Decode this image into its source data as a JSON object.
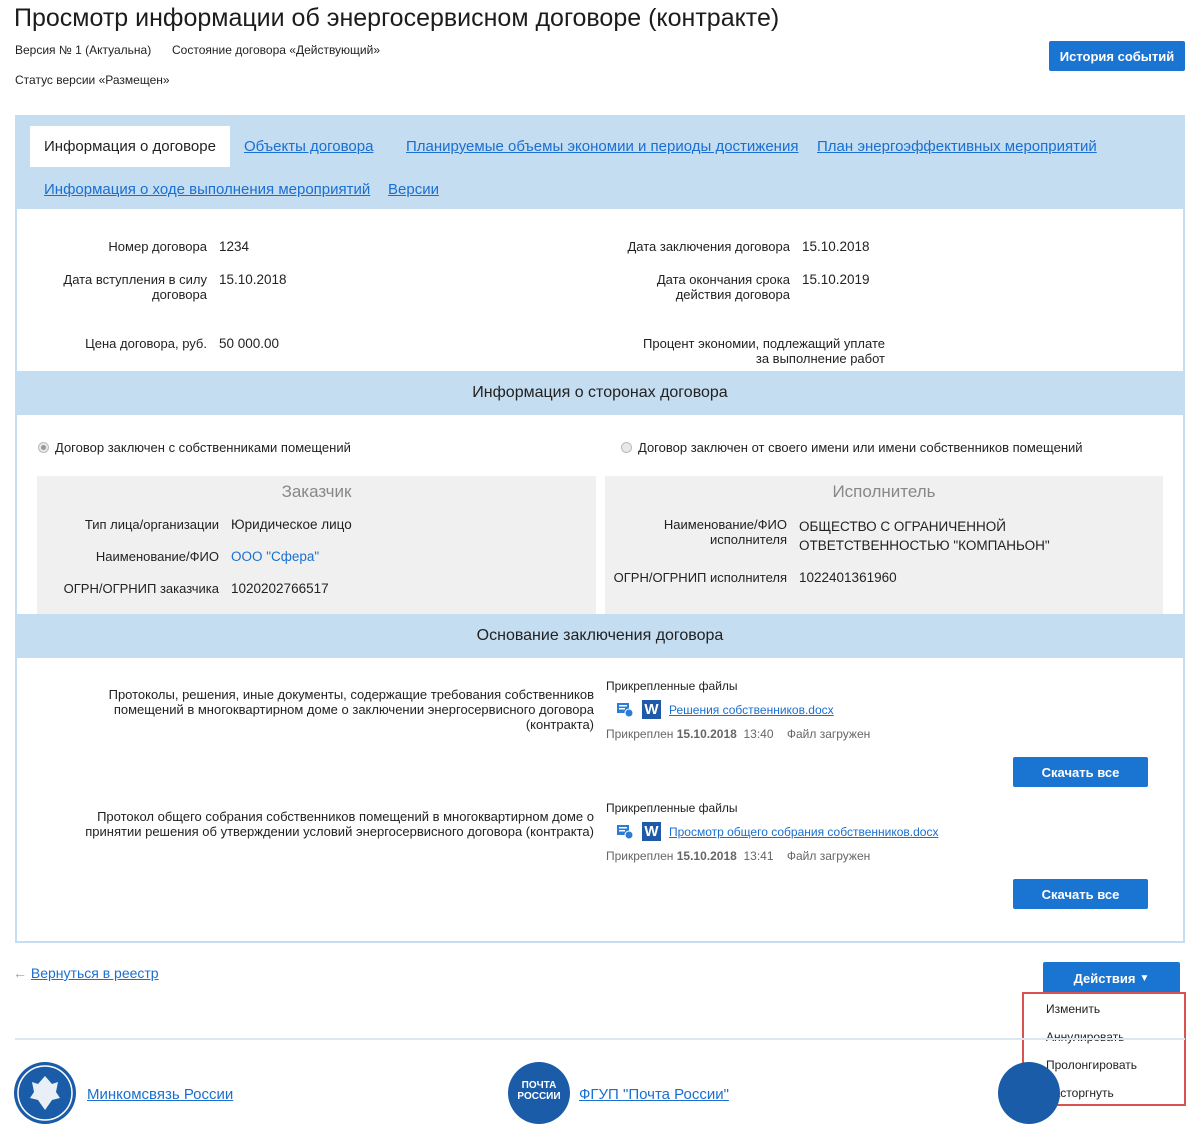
{
  "header": {
    "title": "Просмотр информации об энергосервисном договоре (контракте)",
    "version": "Версия № 1 (Актуальна)",
    "state": "Состояние договора «Действующий»",
    "version_status": "Статус версии «Размещен»",
    "history_button": "История событий"
  },
  "tabs": [
    {
      "label": "Информация о договоре",
      "active": true
    },
    {
      "label": "Объекты договора",
      "active": false
    },
    {
      "label": "Планируемые объемы экономии и периоды достижения",
      "active": false
    },
    {
      "label": "План энергоэффективных мероприятий",
      "active": false
    },
    {
      "label": "Информация о ходе выполнения мероприятий",
      "active": false
    },
    {
      "label": "Версии",
      "active": false
    }
  ],
  "contract": {
    "number_label": "Номер договора",
    "number": "1234",
    "effective_label": "Дата вступления в силу договора",
    "effective_date": "15.10.2018",
    "price_label": "Цена договора, руб.",
    "price": "50 000.00",
    "concluded_label": "Дата заключения договора",
    "concluded_date": "15.10.2018",
    "end_label": "Дата окончания срока действия договора",
    "end_date": "15.10.2019",
    "savings_label": "Процент экономии, подлежащий уплате за выполнение работ"
  },
  "parties": {
    "heading": "Информация о сторонах договора",
    "radio_owners": "Договор заключен с собственниками помещений",
    "radio_self": "Договор заключен от своего имени или имени собственников помещений",
    "customer": {
      "title": "Заказчик",
      "type_label": "Тип лица/организации",
      "type_value": "Юридическое лицо",
      "name_label": "Наименование/ФИО",
      "name_value": "ООО \"Сфера\"",
      "ogrn_label": "ОГРН/ОГРНИП заказчика",
      "ogrn_value": "1020202766517"
    },
    "executor": {
      "title": "Исполнитель",
      "name_label": "Наименование/ФИО исполнителя",
      "name_value": "ОБЩЕСТВО С ОГРАНИЧЕННОЙ ОТВЕТСТВЕННОСТЬЮ \"КОМПАНЬОН\"",
      "ogrn_label": "ОГРН/ОГРНИП исполнителя",
      "ogrn_value": "1022401361960"
    }
  },
  "basis": {
    "heading": "Основание заключения договора",
    "docs": [
      {
        "label": "Протоколы, решения, иные документы, содержащие требования собственников помещений в многоквартирном доме о заключении энергосервисного договора (контракта)",
        "files_label": "Прикрепленные файлы",
        "file_name": "Решения собственников.docx",
        "attached_prefix": "Прикреплен",
        "attached_date": "15.10.2018",
        "attached_time": "13:40",
        "status": "Файл загружен",
        "download": "Скачать все"
      },
      {
        "label": "Протокол общего собрания собственников помещений в многоквартирном доме о принятии решения об утверждении условий энергосервисного договора (контракта)",
        "files_label": "Прикрепленные файлы",
        "file_name": "Просмотр общего собрания собственников.docx",
        "attached_prefix": "Прикреплен",
        "attached_date": "15.10.2018",
        "attached_time": "13:41",
        "status": "Файл загружен",
        "download": "Скачать все"
      }
    ]
  },
  "footer_nav": {
    "back": "Вернуться в реестр",
    "actions": "Действия",
    "menu": [
      "Изменить",
      "Аннулировать",
      "Пролонгировать",
      "Расторгнуть"
    ]
  },
  "footer": {
    "link1": "Минкомсвязь России",
    "link2": "ФГУП \"Почта России\"",
    "post_logo_line1": "ПОЧТА",
    "post_logo_line2": "РОССИИ"
  },
  "colors": {
    "accent": "#1a75d2",
    "band": "#c4ddf1",
    "highlight_border": "#d9534f"
  }
}
